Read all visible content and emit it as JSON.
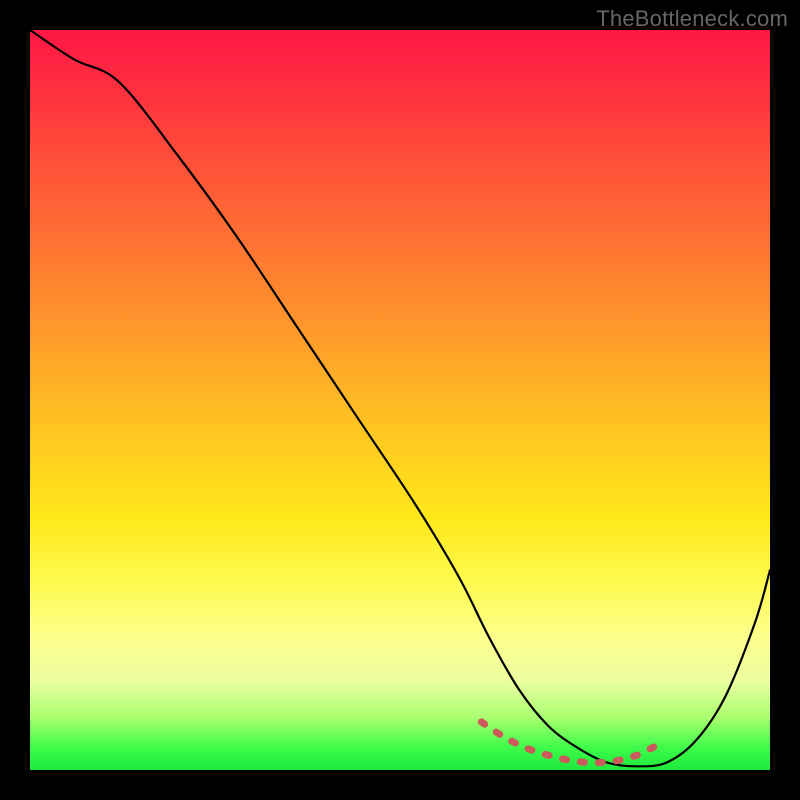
{
  "watermark": "TheBottleneck.com",
  "chart_data": {
    "type": "line",
    "title": "",
    "xlabel": "",
    "ylabel": "",
    "xlim": [
      0,
      100
    ],
    "ylim": [
      0,
      100
    ],
    "series": [
      {
        "name": "black-curve",
        "x": [
          0,
          6,
          12,
          20,
          28,
          36,
          44,
          52,
          58,
          62,
          66,
          70,
          74,
          78,
          82,
          86,
          90,
          94,
          98,
          100
        ],
        "values": [
          100,
          96,
          93,
          83,
          72,
          60,
          48,
          36,
          26,
          18,
          11,
          6,
          3,
          1,
          0.5,
          1,
          4,
          10,
          20,
          27
        ]
      },
      {
        "name": "red-dashed-segment",
        "x": [
          61,
          64,
          67,
          70,
          73,
          76,
          79,
          82,
          85
        ],
        "values": [
          6.5,
          4.5,
          3,
          2,
          1.3,
          1,
          1.2,
          2,
          3.5
        ]
      }
    ],
    "colors": {
      "background_gradient_top": "#ff1744",
      "background_gradient_mid": "#ffe81a",
      "background_gradient_bottom": "#1de93c",
      "curve": "#000000",
      "dashed_segment": "#cc5a5a"
    }
  }
}
